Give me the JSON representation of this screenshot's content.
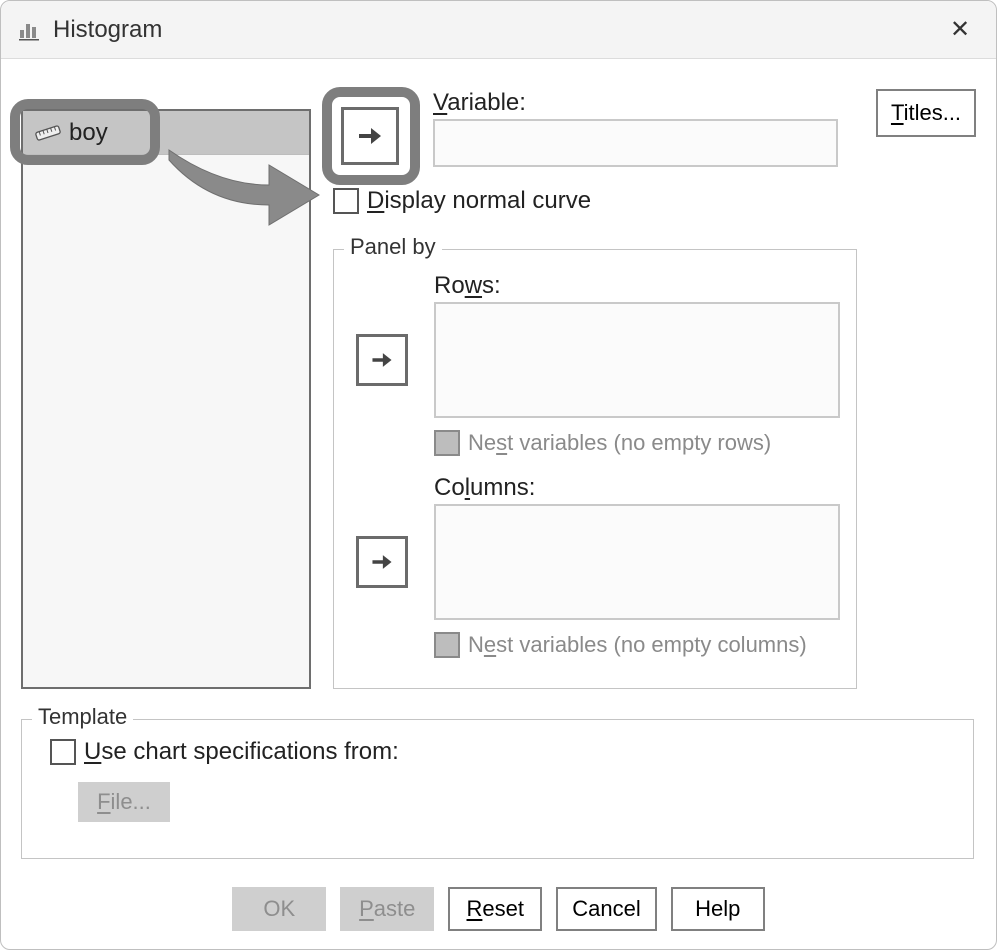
{
  "window": {
    "title": "Histogram",
    "close_glyph": "✕"
  },
  "varlist": {
    "items": [
      {
        "label": "boy"
      }
    ]
  },
  "main": {
    "variable_label": "Variable:",
    "variable_value": "",
    "titles_button": "Titles...",
    "display_normal_curve_label": "Display normal curve",
    "display_normal_curve_checked": false
  },
  "panel_by": {
    "legend": "Panel by",
    "rows_label": "Rows:",
    "rows_nest_label": "Nest variables (no empty rows)",
    "columns_label": "Columns:",
    "columns_nest_label": "Nest variables (no empty columns)"
  },
  "template": {
    "legend": "Template",
    "use_chart_specs_label": "Use chart specifications from:",
    "use_chart_specs_checked": false,
    "file_button": "File..."
  },
  "buttons": {
    "ok": "OK",
    "paste": "Paste",
    "reset": "Reset",
    "cancel": "Cancel",
    "help": "Help"
  }
}
